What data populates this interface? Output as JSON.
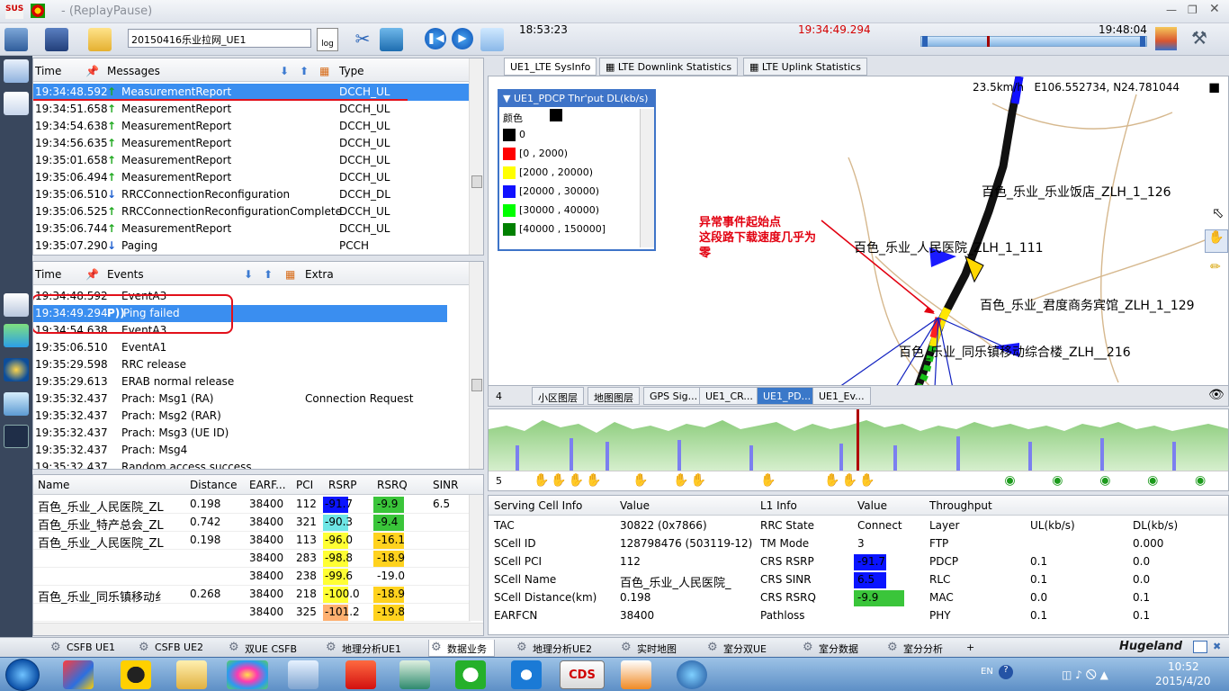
{
  "window": {
    "title": "- (ReplayPause)"
  },
  "toolbar": {
    "filename": "20150416乐业拉网_UE1",
    "time_start": "18:53:23",
    "time_current": "19:34:49.294",
    "time_end": "19:48:04"
  },
  "messages": {
    "headers": [
      "Time",
      "Messages",
      "Type"
    ],
    "rows": [
      {
        "time": "19:34:48.592",
        "dir": "up",
        "msg": "MeasurementReport",
        "type": "DCCH_UL"
      },
      {
        "time": "19:34:51.658",
        "dir": "up",
        "msg": "MeasurementReport",
        "type": "DCCH_UL"
      },
      {
        "time": "19:34:54.638",
        "dir": "up",
        "msg": "MeasurementReport",
        "type": "DCCH_UL"
      },
      {
        "time": "19:34:56.635",
        "dir": "up",
        "msg": "MeasurementReport",
        "type": "DCCH_UL"
      },
      {
        "time": "19:35:01.658",
        "dir": "up",
        "msg": "MeasurementReport",
        "type": "DCCH_UL"
      },
      {
        "time": "19:35:06.494",
        "dir": "up",
        "msg": "MeasurementReport",
        "type": "DCCH_UL"
      },
      {
        "time": "19:35:06.510",
        "dir": "down",
        "msg": "RRCConnectionReconfiguration",
        "type": "DCCH_DL"
      },
      {
        "time": "19:35:06.525",
        "dir": "up",
        "msg": "RRCConnectionReconfigurationComplete",
        "type": "DCCH_UL"
      },
      {
        "time": "19:35:06.744",
        "dir": "up",
        "msg": "MeasurementReport",
        "type": "DCCH_UL"
      },
      {
        "time": "19:35:07.290",
        "dir": "down",
        "msg": "Paging",
        "type": "PCCH"
      }
    ]
  },
  "events": {
    "headers": [
      "Time",
      "Events",
      "Extra"
    ],
    "rows": [
      {
        "time": "19:34:48.592",
        "event": "EventA3",
        "extra": ""
      },
      {
        "time": "19:34:49.294",
        "event": "Ping failed",
        "extra": ""
      },
      {
        "time": "19:34:54.638",
        "event": "EventA3",
        "extra": ""
      },
      {
        "time": "19:35:06.510",
        "event": "EventA1",
        "extra": ""
      },
      {
        "time": "19:35:29.598",
        "event": "RRC release",
        "extra": ""
      },
      {
        "time": "19:35:29.613",
        "event": "ERAB normal release",
        "extra": ""
      },
      {
        "time": "19:35:32.437",
        "event": "Prach: Msg1 (RA)",
        "extra": "Connection Request"
      },
      {
        "time": "19:35:32.437",
        "event": "Prach: Msg2 (RAR)",
        "extra": ""
      },
      {
        "time": "19:35:32.437",
        "event": "Prach: Msg3 (UE ID)",
        "extra": ""
      },
      {
        "time": "19:35:32.437",
        "event": "Prach: Msg4",
        "extra": ""
      },
      {
        "time": "19:35:32.437",
        "event": "Random access success",
        "extra": ""
      }
    ]
  },
  "cells": {
    "headers": [
      "Name",
      "Distance",
      "EARF...",
      "PCI",
      "RSRP",
      "RSRQ",
      "SINR"
    ],
    "rows": [
      {
        "name": "百色_乐业_人民医院_ZL",
        "dist": "0.198",
        "earfcn": "38400",
        "pci": "112",
        "rsrp": "-91.7",
        "rsrp_color": "#0a14ff",
        "rsrq": "-9.9",
        "rsrq_color": "#3ac53a",
        "sinr": "6.5"
      },
      {
        "name": "百色_乐业_特产总会_ZL",
        "dist": "0.742",
        "earfcn": "38400",
        "pci": "321",
        "rsrp": "-90.3",
        "rsrp_color": "#6ee6e6",
        "rsrq": "-9.4",
        "rsrq_color": "#3ac53a",
        "sinr": ""
      },
      {
        "name": "百色_乐业_人民医院_ZL",
        "dist": "0.198",
        "earfcn": "38400",
        "pci": "113",
        "rsrp": "-96.0",
        "rsrp_color": "#ffff33",
        "rsrq": "-16.1",
        "rsrq_color": "#ffd21e",
        "sinr": ""
      },
      {
        "name": "",
        "dist": "",
        "earfcn": "38400",
        "pci": "283",
        "rsrp": "-98.8",
        "rsrp_color": "#ffff33",
        "rsrq": "-18.9",
        "rsrq_color": "#ffd21e",
        "sinr": ""
      },
      {
        "name": "",
        "dist": "",
        "earfcn": "38400",
        "pci": "238",
        "rsrp": "-99.6",
        "rsrp_color": "#ffff33",
        "rsrq": "-19.0",
        "rsrq_color": "",
        "sinr": ""
      },
      {
        "name": "百色_乐业_同乐镇移动纟",
        "dist": "0.268",
        "earfcn": "38400",
        "pci": "218",
        "rsrp": "-100.0",
        "rsrp_color": "#ffff33",
        "rsrq": "-18.9",
        "rsrq_color": "#ffd21e",
        "sinr": ""
      },
      {
        "name": "",
        "dist": "",
        "earfcn": "38400",
        "pci": "325",
        "rsrp": "-101.2",
        "rsrp_color": "#ffb070",
        "rsrq": "-19.8",
        "rsrq_color": "#ffd21e",
        "sinr": ""
      }
    ]
  },
  "map": {
    "tabs": [
      "UE1_LTE SysInfo",
      "LTE Downlink Statistics",
      "LTE Uplink Statistics"
    ],
    "speed_coord": "23.5km/h   E106.552734, N24.781044",
    "legend_title": "UE1_PDCP Thr'put DL(kb/s)",
    "legend_color_label": "颜色",
    "legend_items": [
      {
        "label": "0",
        "color": "#000000"
      },
      {
        "label": "[0 , 2000)",
        "color": "#ff0000"
      },
      {
        "label": "[2000 , 20000)",
        "color": "#ffff00"
      },
      {
        "label": "[20000 , 30000)",
        "color": "#1010ff"
      },
      {
        "label": "[30000 , 40000)",
        "color": "#00ff00"
      },
      {
        "label": "[40000 , 150000]",
        "color": "#008000"
      }
    ],
    "annotation_line1": "异常事件起始点",
    "annotation_line2": "这段路下载速度几乎为",
    "annotation_line3": "零",
    "cell_labels": [
      "百色_乐业_乐业饭店_ZLH_1_126",
      "百色_乐业_人民医院_ZLH_1_111",
      "百色_乐业_君度商务宾馆_ZLH_1_129",
      "百色_乐业_同乐镇移动综合楼_ZLH__216"
    ],
    "layer_count": "4",
    "layer_tabs": [
      "小区图层",
      "地图图层",
      "GPS Sig...",
      "UE1_CR...",
      "UE1_PD...",
      "UE1_Ev..."
    ]
  },
  "chart_strip": {
    "count": "5"
  },
  "info": {
    "headers": [
      "Serving Cell Info",
      "Value",
      "L1 Info",
      "Value",
      "Throughput",
      "",
      ""
    ],
    "serving": [
      {
        "k": "TAC",
        "v": "30822 (0x7866)"
      },
      {
        "k": "SCell ID",
        "v": "128798476 (503119-12) (0"
      },
      {
        "k": "SCell PCI",
        "v": "112"
      },
      {
        "k": "SCell Name",
        "v": "百色_乐业_人民医院_"
      },
      {
        "k": "SCell Distance(km)",
        "v": "0.198"
      },
      {
        "k": "EARFCN",
        "v": "38400"
      }
    ],
    "l1": [
      {
        "k": "RRC State",
        "v": "Connect",
        "c": ""
      },
      {
        "k": "TM Mode",
        "v": "3",
        "c": ""
      },
      {
        "k": "CRS RSRP",
        "v": "-91.7",
        "c": "#0a14ff"
      },
      {
        "k": "CRS SINR",
        "v": "6.5",
        "c": "#0a14ff"
      },
      {
        "k": "CRS RSRQ",
        "v": "-9.9",
        "c": "#3ac53a"
      },
      {
        "k": "Pathloss",
        "v": "",
        "c": ""
      }
    ],
    "tp": [
      {
        "layer": "Layer",
        "ul": "UL(kb/s)",
        "dl": "DL(kb/s)"
      },
      {
        "layer": "FTP",
        "ul": "",
        "dl": "0.000"
      },
      {
        "layer": "PDCP",
        "ul": "0.1",
        "dl": "0.0"
      },
      {
        "layer": "RLC",
        "ul": "0.1",
        "dl": "0.0"
      },
      {
        "layer": "MAC",
        "ul": "0.0",
        "dl": "0.1"
      },
      {
        "layer": "PHY",
        "ul": "0.1",
        "dl": "0.1"
      }
    ]
  },
  "bottom_tabs": [
    "CSFB UE1",
    "CSFB UE2",
    "双UE  CSFB",
    "地理分析UE1",
    "数据业务",
    "地理分析UE2",
    "实时地图",
    "室分双UE",
    "室分数据",
    "室分分析",
    "+"
  ],
  "brand": "Hugeland",
  "taskbar": {
    "lang": "EN",
    "time": "10:52",
    "date": "2015/4/20"
  }
}
